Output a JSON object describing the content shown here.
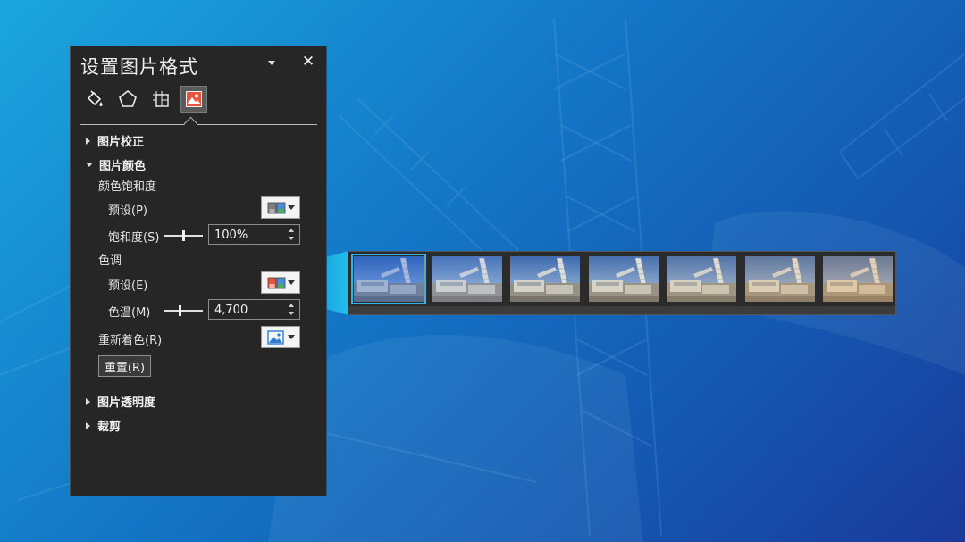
{
  "pane": {
    "title": "设置图片格式",
    "tabs": [
      {
        "name": "fill-line",
        "icon": "paint-bucket-icon"
      },
      {
        "name": "effects",
        "icon": "pentagon-icon"
      },
      {
        "name": "size-properties",
        "icon": "size-layout-icon"
      },
      {
        "name": "picture",
        "icon": "picture-icon",
        "selected": true
      }
    ],
    "sections": {
      "correction": "图片校正",
      "color": "图片颜色",
      "transparency": "图片透明度",
      "crop": "裁剪"
    },
    "saturation_group": "颜色饱和度",
    "saturation_preset_label": "预设(P)",
    "saturation_label": "饱和度(S)",
    "saturation_value": "100%",
    "tone_group": "色调",
    "tone_preset_label": "预设(E)",
    "temperature_label": "色温(M)",
    "temperature_value": "4,700",
    "recolor_label": "重新着色(R)",
    "reset_label": "重置(R)"
  },
  "sliders": {
    "saturation_fraction": 0.5,
    "temperature_fraction": 0.42
  },
  "gallery": {
    "icon": "color-temperature-presets",
    "selected_index": 0,
    "presets": [
      {
        "tint": "#3a6fd8",
        "alpha": 0.35
      },
      {
        "tint": "#9fb2d6",
        "alpha": 0.25
      },
      {
        "tint": "#c9c0a8",
        "alpha": 0.12
      },
      {
        "tint": "#d9c9a0",
        "alpha": 0.16
      },
      {
        "tint": "#e0c18c",
        "alpha": 0.22
      },
      {
        "tint": "#e6b877",
        "alpha": 0.28
      },
      {
        "tint": "#eaae62",
        "alpha": 0.34
      }
    ]
  },
  "colors": {
    "accent": "#2fb4e6",
    "pane_bg": "#262626"
  }
}
